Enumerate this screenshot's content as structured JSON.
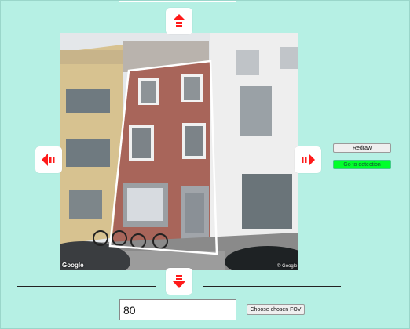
{
  "photo": {
    "logo_text": "Google",
    "copyright_text": "© Google"
  },
  "controls": {
    "up_icon": "arrow-up-icon",
    "down_icon": "arrow-down-icon",
    "left_icon": "arrow-left-icon",
    "right_icon": "arrow-right-icon",
    "arrow_color": "#ff1a1a",
    "redraw_label": "Redraw",
    "detection_label": "Go to detection",
    "detection_color": "#00ff2a"
  },
  "fov": {
    "value": "80",
    "button_label": "Choose chosen FOV"
  },
  "colors": {
    "background": "#b6f0e4",
    "outline": "#ffffff"
  }
}
